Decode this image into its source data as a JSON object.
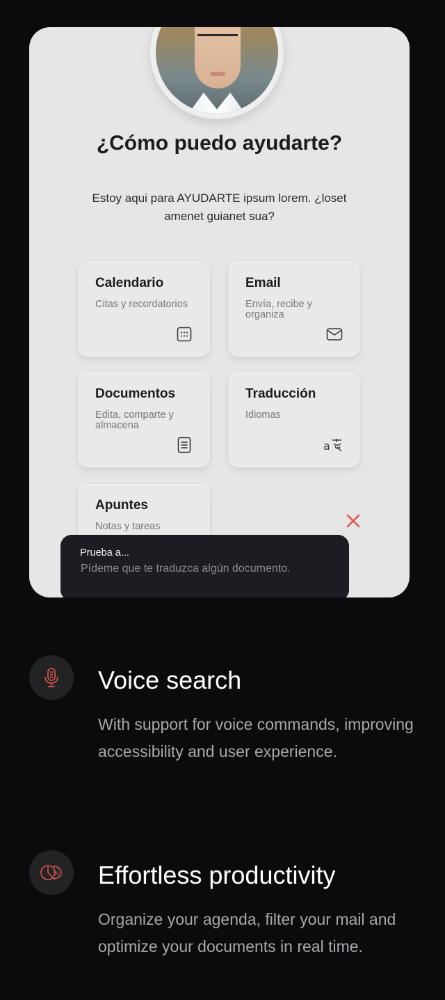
{
  "assistant": {
    "title": "¿Cómo puedo ayudarte?",
    "subtitle": "Estoy aqui para AYUDARTE ipsum lorem. ¿loset amenet guianet sua?",
    "cards": [
      {
        "title": "Calendario",
        "desc": "Citas y recordatorios",
        "icon": "calendar-icon"
      },
      {
        "title": "Email",
        "desc": "Envía, recibe y organiza",
        "icon": "mail-icon"
      },
      {
        "title": "Documentos",
        "desc": "Edita, comparte y almacena",
        "icon": "document-icon"
      },
      {
        "title": "Traducción",
        "desc": "Idiomas",
        "icon": "translate-icon"
      },
      {
        "title": "Apuntes",
        "desc": "Notas y tareas",
        "icon": "notes-icon"
      }
    ],
    "prompt": {
      "label": "Prueba a...",
      "text": "Pídeme que te traduzca algún documento."
    },
    "accent_color": "#e0564f"
  },
  "features": [
    {
      "icon": "microphone-icon",
      "title": "Voice search",
      "desc": "With support for voice commands, improving accessibility and user experience."
    },
    {
      "icon": "productivity-icon",
      "title": "Effortless productivity",
      "desc": "Organize your agenda, filter your mail and optimize your documents in real time."
    }
  ]
}
